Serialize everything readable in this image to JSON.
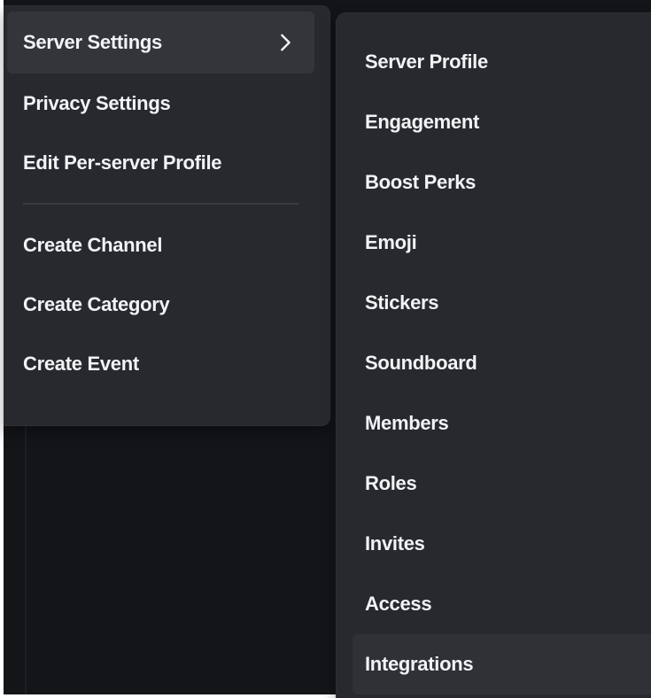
{
  "context_menu": {
    "items": [
      {
        "label": "Server Settings",
        "has_submenu": true
      },
      {
        "label": "Privacy Settings"
      },
      {
        "label": "Edit Per-server Profile"
      },
      {
        "label": "Create Channel"
      },
      {
        "label": "Create Category"
      },
      {
        "label": "Create Event"
      }
    ]
  },
  "submenu": {
    "items": [
      {
        "label": "Server Profile"
      },
      {
        "label": "Engagement"
      },
      {
        "label": "Boost Perks"
      },
      {
        "label": "Emoji"
      },
      {
        "label": "Stickers"
      },
      {
        "label": "Soundboard"
      },
      {
        "label": "Members"
      },
      {
        "label": "Roles"
      },
      {
        "label": "Invites"
      },
      {
        "label": "Access"
      },
      {
        "label": "Integrations"
      }
    ]
  },
  "icons": {
    "submenu_indicator": "chevron-right-icon"
  },
  "colors": {
    "menu_background": "#28292e",
    "item_hover": "#33353b",
    "text": "#f2f3f5",
    "backdrop": "#141519"
  }
}
